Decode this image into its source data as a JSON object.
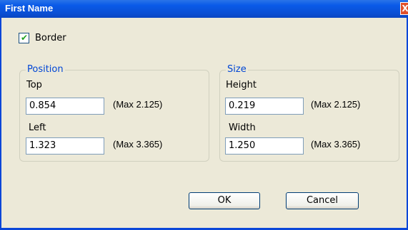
{
  "window": {
    "title": "First Name",
    "close_glyph": "X"
  },
  "border_checkbox": {
    "label": "Border",
    "checked": true
  },
  "position_group": {
    "title": "Position",
    "top": {
      "label": "Top",
      "value": "0.854",
      "max": "(Max 2.125)"
    },
    "left": {
      "label": "Left",
      "value": "1.323",
      "max": "(Max 3.365)"
    }
  },
  "size_group": {
    "title": "Size",
    "height": {
      "label": "Height",
      "value": "0.219",
      "max": "(Max 2.125)"
    },
    "width": {
      "label": "Width",
      "value": "1.250",
      "max": "(Max 3.365)"
    }
  },
  "buttons": {
    "ok": "OK",
    "cancel": "Cancel"
  },
  "colors": {
    "titlebar": "#0a5ae8",
    "dialog_bg": "#ece9d8",
    "group_title": "#0046d5",
    "close": "#e0502a"
  },
  "icons": {
    "close": "close-icon",
    "check": "checkmark-icon"
  }
}
